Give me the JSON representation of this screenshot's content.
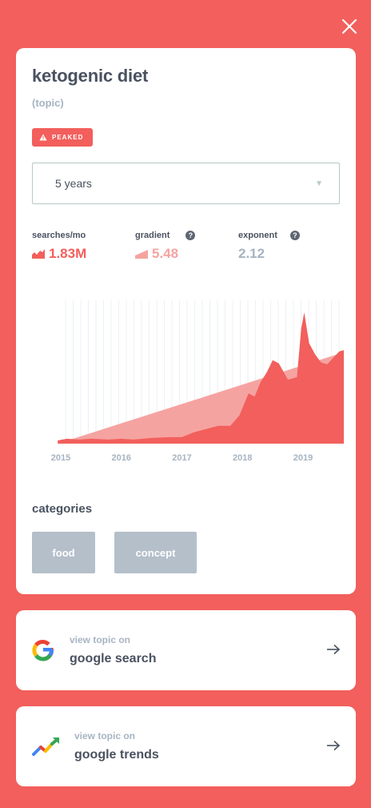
{
  "topic": {
    "title": "ketogenic diet",
    "type": "(topic)",
    "status": "PEAKED"
  },
  "timeframe": {
    "selected": "5 years"
  },
  "metrics": [
    {
      "label": "searches/mo",
      "value": "1.83M",
      "color": "#f25f5c"
    },
    {
      "label": "gradient",
      "value": "5.48",
      "color": "#f5a3a1"
    },
    {
      "label": "exponent",
      "value": "2.12",
      "color": "#a7b4c2"
    }
  ],
  "chart_data": {
    "type": "area",
    "x_ticks": [
      "2015",
      "2016",
      "2017",
      "2018",
      "2019"
    ],
    "x_range": [
      2015.0,
      2019.85
    ],
    "series": [
      {
        "color": "#f25f5c",
        "points": [
          [
            2014.95,
            4
          ],
          [
            2015.1,
            6
          ],
          [
            2015.3,
            5
          ],
          [
            2015.5,
            6
          ],
          [
            2015.8,
            5
          ],
          [
            2016.0,
            6
          ],
          [
            2016.2,
            5
          ],
          [
            2016.5,
            7
          ],
          [
            2016.8,
            8
          ],
          [
            2017.0,
            8
          ],
          [
            2017.2,
            14
          ],
          [
            2017.4,
            18
          ],
          [
            2017.6,
            22
          ],
          [
            2017.8,
            22
          ],
          [
            2017.95,
            35
          ],
          [
            2018.1,
            62
          ],
          [
            2018.2,
            58
          ],
          [
            2018.3,
            76
          ],
          [
            2018.4,
            88
          ],
          [
            2018.5,
            103
          ],
          [
            2018.6,
            99
          ],
          [
            2018.75,
            79
          ],
          [
            2018.9,
            82
          ],
          [
            2018.97,
            142
          ],
          [
            2019.02,
            162
          ],
          [
            2019.1,
            124
          ],
          [
            2019.2,
            110
          ],
          [
            2019.3,
            100
          ],
          [
            2019.4,
            98
          ],
          [
            2019.5,
            106
          ],
          [
            2019.6,
            114
          ],
          [
            2019.7,
            116
          ],
          [
            2019.8,
            104
          ],
          [
            2019.85,
            100
          ]
        ]
      },
      {
        "color": "#f5a3a1",
        "points": [
          [
            2014.95,
            0
          ],
          [
            2019.85,
            117
          ]
        ]
      }
    ],
    "y_range": [
      0,
      172
    ]
  },
  "categories": {
    "title": "categories",
    "items": [
      "food",
      "concept"
    ]
  },
  "links": [
    {
      "small": "view topic on",
      "big": "google search",
      "icon": "google-icon"
    },
    {
      "small": "view topic on",
      "big": "google trends",
      "icon": "google-trends-icon"
    }
  ]
}
